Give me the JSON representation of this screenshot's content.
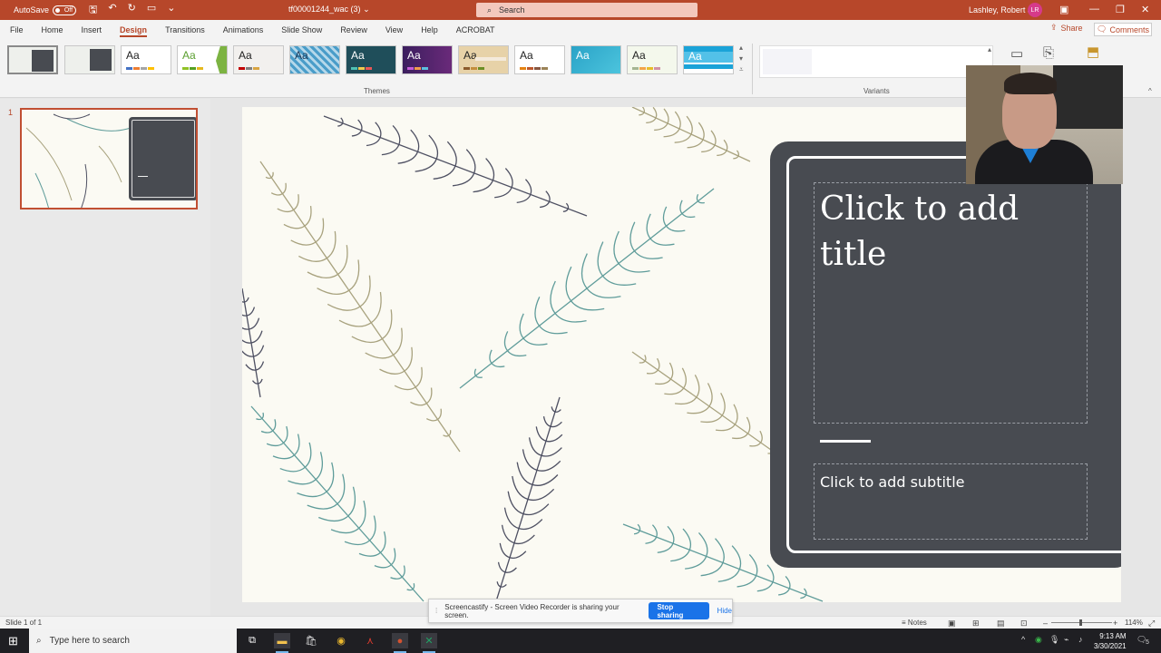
{
  "titlebar": {
    "autosave_label": "AutoSave",
    "autosave_state": "Off",
    "filename": "tf00001244_wac (3)",
    "search_placeholder": "Search",
    "user_name": "Lashley, Robert J",
    "user_initials": "LR"
  },
  "tabs": [
    "File",
    "Home",
    "Insert",
    "Design",
    "Transitions",
    "Animations",
    "Slide Show",
    "Review",
    "View",
    "Help",
    "ACROBAT"
  ],
  "active_tab": "Design",
  "actions": {
    "share": "Share",
    "comments": "Comments"
  },
  "ribbon": {
    "themes_label": "Themes",
    "variants_label": "Variants",
    "theme_glyph": "Aa"
  },
  "slide_panel": {
    "slide_number": "1"
  },
  "slide": {
    "title_placeholder": "Click to add title",
    "subtitle_placeholder": "Click to add subtitle"
  },
  "statusbar": {
    "slide_info": "Slide 1 of 1",
    "notes_label": "Notes",
    "zoom_level": "114%"
  },
  "share_bar": {
    "message": "Screencastify - Screen Video Recorder is sharing your screen.",
    "stop_label": "Stop sharing",
    "hide_label": "Hide"
  },
  "taskbar": {
    "search_placeholder": "Type here to search",
    "time": "9:13 AM",
    "date": "3/30/2021",
    "notification_count": "5"
  },
  "colors": {
    "accent": "#b7472a",
    "panel_dark": "#484b51",
    "feather_teal": "#5f9c9a",
    "feather_tan": "#a8a27e",
    "feather_navy": "#4e5062"
  }
}
